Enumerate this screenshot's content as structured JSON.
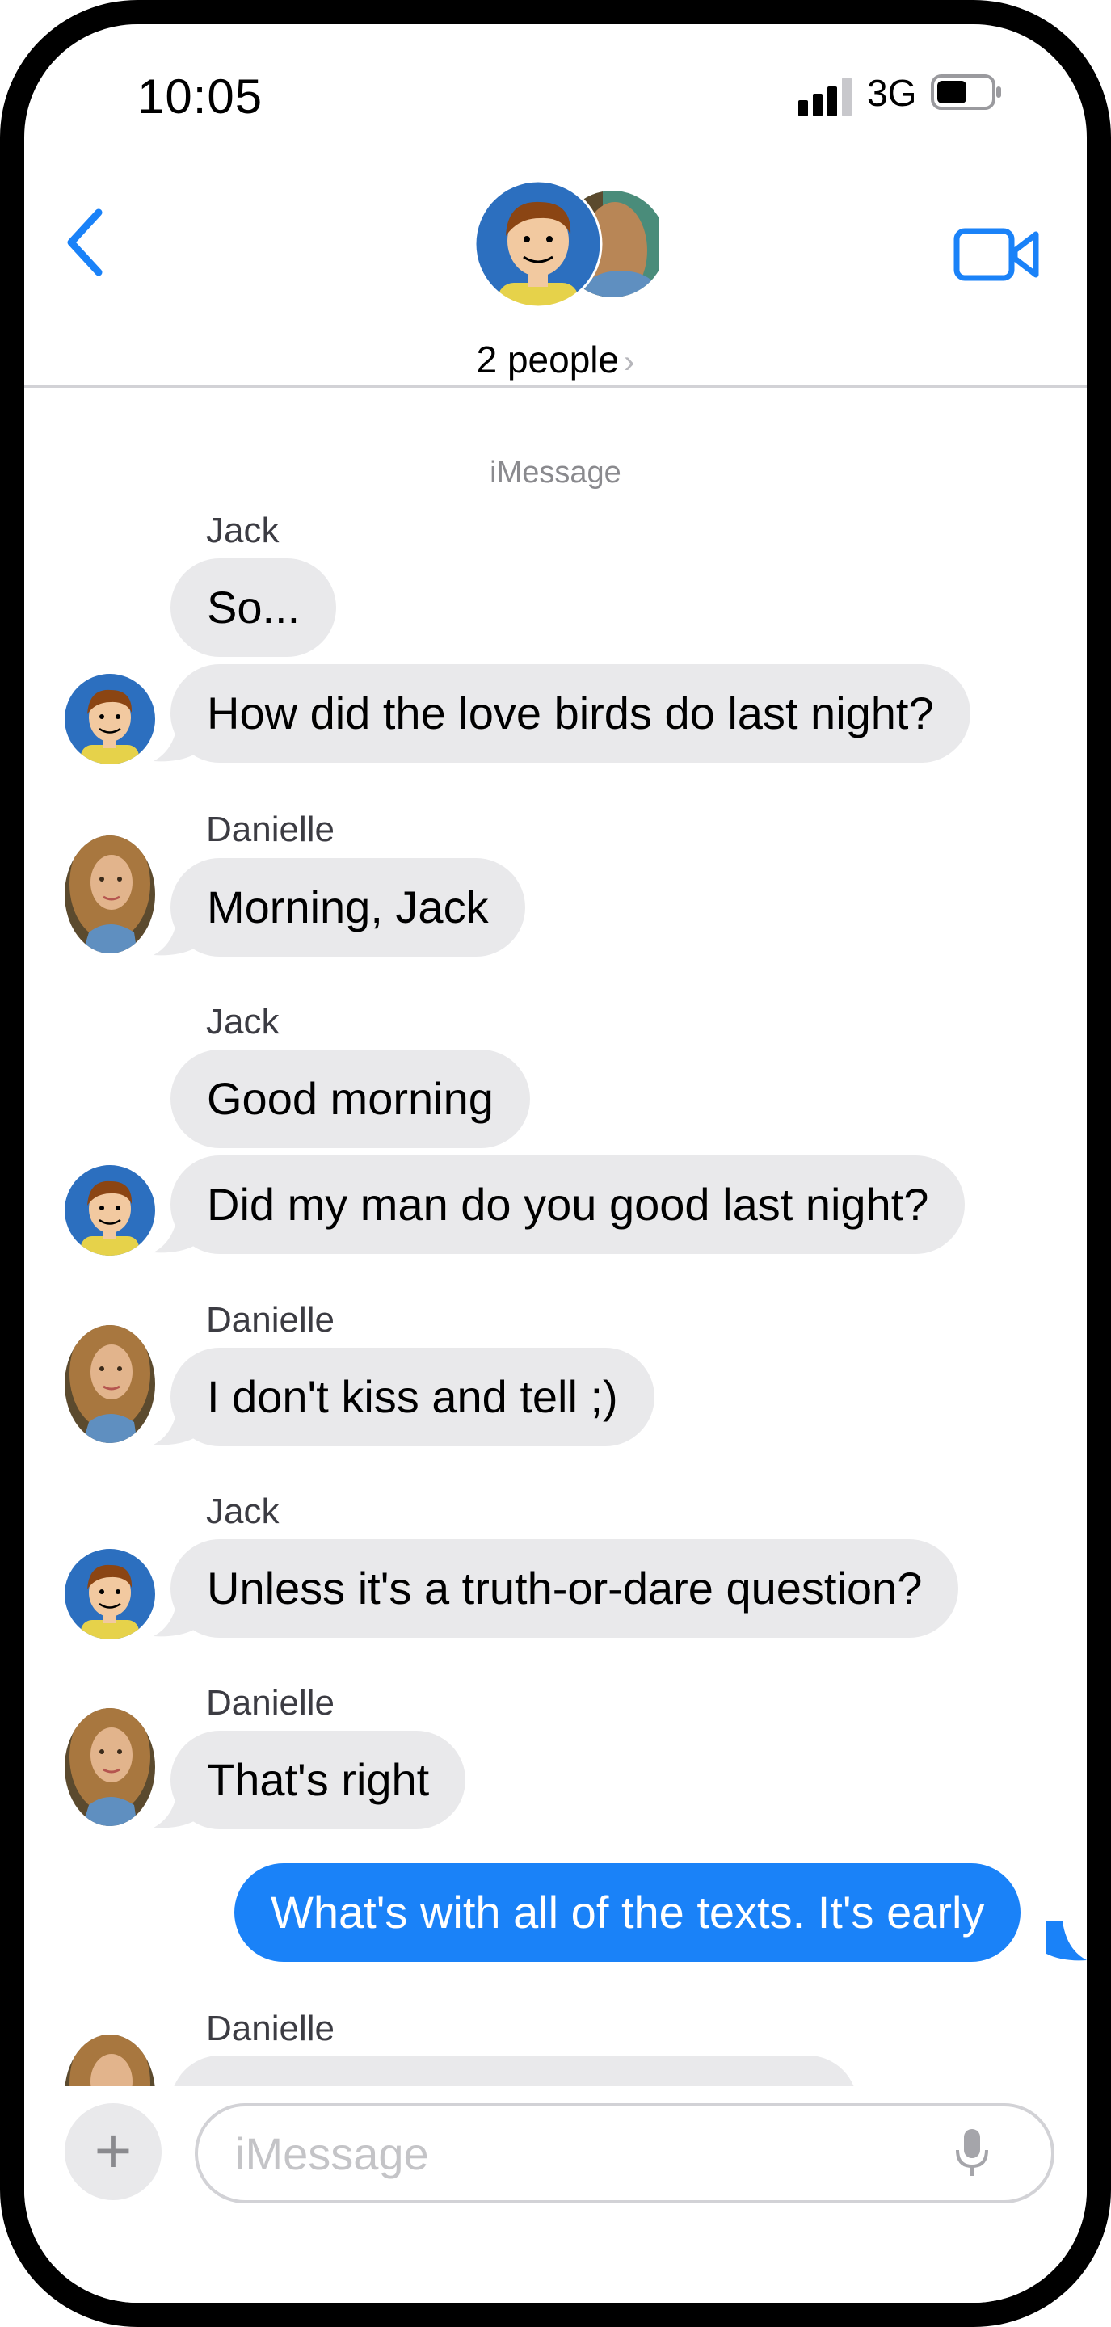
{
  "status_bar": {
    "time": "10:05",
    "network": "3G"
  },
  "header": {
    "participants_label": "2 people",
    "chevron": "›"
  },
  "thread": {
    "service_label": "iMessage",
    "messages": [
      {
        "sender": "Jack",
        "text": "So..."
      },
      {
        "sender": "Jack",
        "text": "How did the love birds do last night?"
      },
      {
        "sender": "Danielle",
        "text": "Morning, Jack"
      },
      {
        "sender": "Jack",
        "text": "Good morning"
      },
      {
        "sender": "Jack",
        "text": "Did my man do you good last night?"
      },
      {
        "sender": "Danielle",
        "text": "I don't kiss and tell ;)"
      },
      {
        "sender": "Jack",
        "text": "Unless it's a truth-or-dare question?"
      },
      {
        "sender": "Danielle",
        "text": "That's right"
      },
      {
        "sender": "me",
        "text": "What's with all of the texts.  It's early"
      },
      {
        "sender": "Danielle",
        "text": ""
      }
    ]
  },
  "composer": {
    "placeholder": "iMessage",
    "plus_label": "+"
  },
  "colors": {
    "accent": "#1a82f8",
    "incoming_bubble": "#e9e9eb",
    "outgoing_bubble": "#1a82f8",
    "jack_avatar_bg": "#2c6fbf"
  },
  "icons": {
    "back": "chevron-left-icon",
    "video": "video-camera-icon",
    "mic": "microphone-icon",
    "add": "plus-icon"
  }
}
